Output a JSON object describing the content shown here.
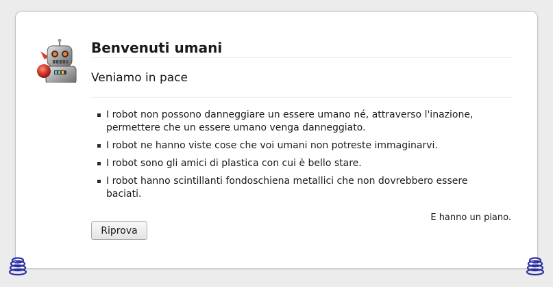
{
  "page": {
    "title": "Benvenuti umani",
    "subtitle": "Veniamo in pace",
    "items": [
      "I robot non possono danneggiare un essere umano né, attraverso l'inazione, permettere che un essere umano venga danneggiato.",
      "I robot ne hanno viste cose che voi umani non potreste immaginarvi.",
      "I robot sono gli amici di plastica con cui è bello stare.",
      "I robot hanno scintillanti fondoschiena metallici che non dovrebbero essere baciati."
    ],
    "note": "E hanno un piano.",
    "retry_label": "Riprova"
  },
  "icons": {
    "robot": "robot-icon",
    "spring": "spring-icon"
  },
  "colors": {
    "background": "#ececec",
    "card": "#ffffff",
    "spring": "#2b2fa5",
    "robot_red": "#d63b2b"
  }
}
